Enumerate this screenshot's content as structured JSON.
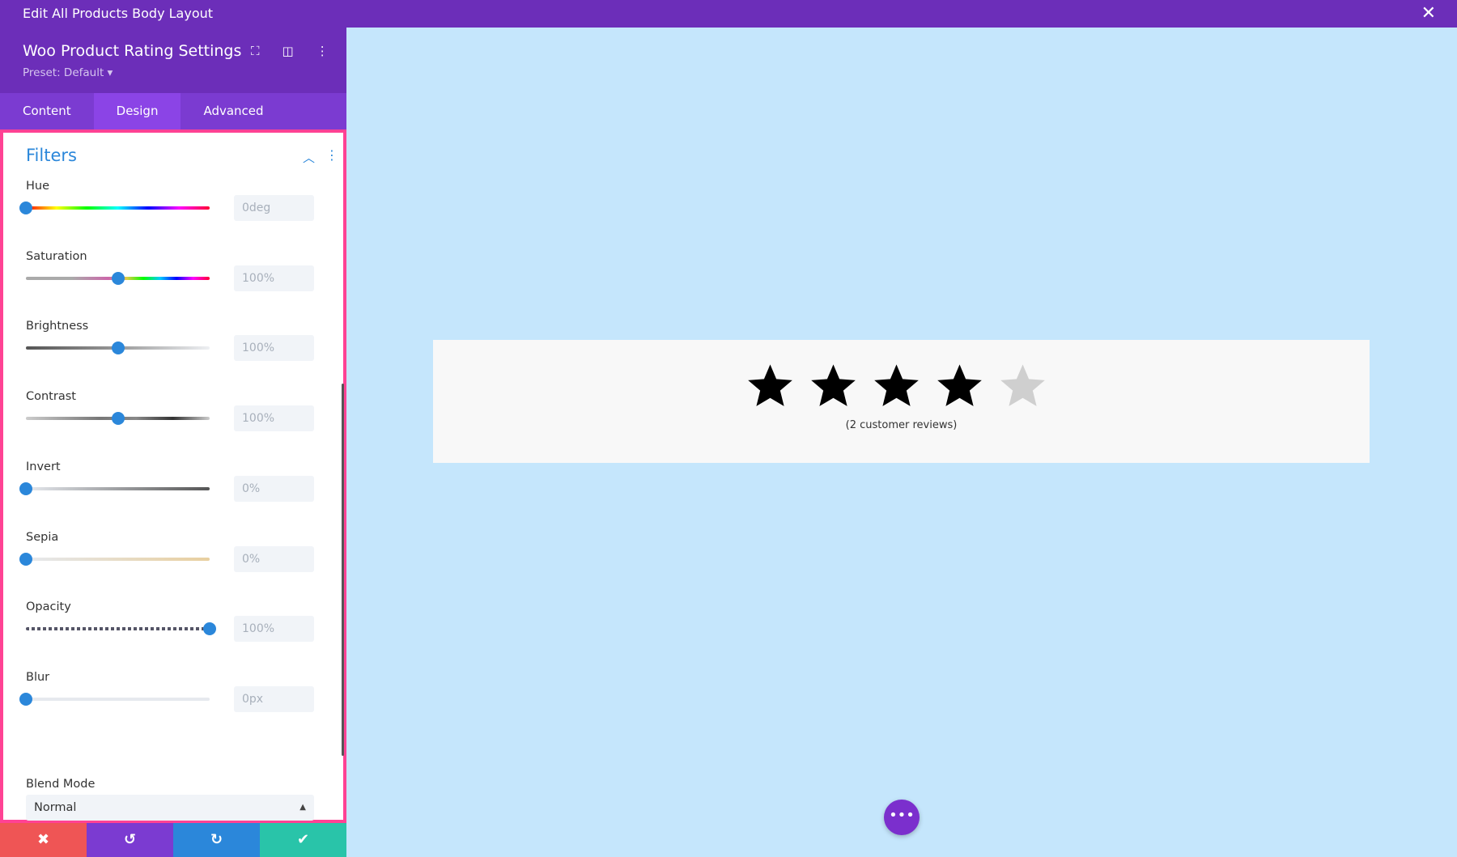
{
  "window": {
    "title": "Edit All Products Body Layout"
  },
  "header": {
    "title": "Woo Product Rating Settings",
    "preset": "Preset: Default ▾"
  },
  "tabs": [
    {
      "label": "Content"
    },
    {
      "label": "Design",
      "active": true
    },
    {
      "label": "Advanced"
    }
  ],
  "section": {
    "title": "Filters"
  },
  "filters": [
    {
      "label": "Hue",
      "value": "0deg",
      "level": 0
    },
    {
      "label": "Saturation",
      "value": "100%",
      "level": 0.5
    },
    {
      "label": "Brightness",
      "value": "100%",
      "level": 0.5
    },
    {
      "label": "Contrast",
      "value": "100%",
      "level": 0.5
    },
    {
      "label": "Invert",
      "value": "0%",
      "level": 0
    },
    {
      "label": "Sepia",
      "value": "0%",
      "level": 0
    },
    {
      "label": "Opacity",
      "value": "100%",
      "level": 1
    },
    {
      "label": "Blur",
      "value": "0px",
      "level": 0
    }
  ],
  "blend": {
    "label": "Blend Mode",
    "value": "Normal"
  },
  "rating": {
    "stars_filled": 4,
    "stars_total": 5,
    "reviews": "(2 customer reviews)"
  },
  "colors": {
    "purple": "#6c2eb9",
    "accent": "#2b87da",
    "highlight": "#ff4294",
    "cancel": "#ef5555",
    "undo": "#7b3bd1",
    "redo": "#2b87da",
    "save": "#29c4a9"
  }
}
